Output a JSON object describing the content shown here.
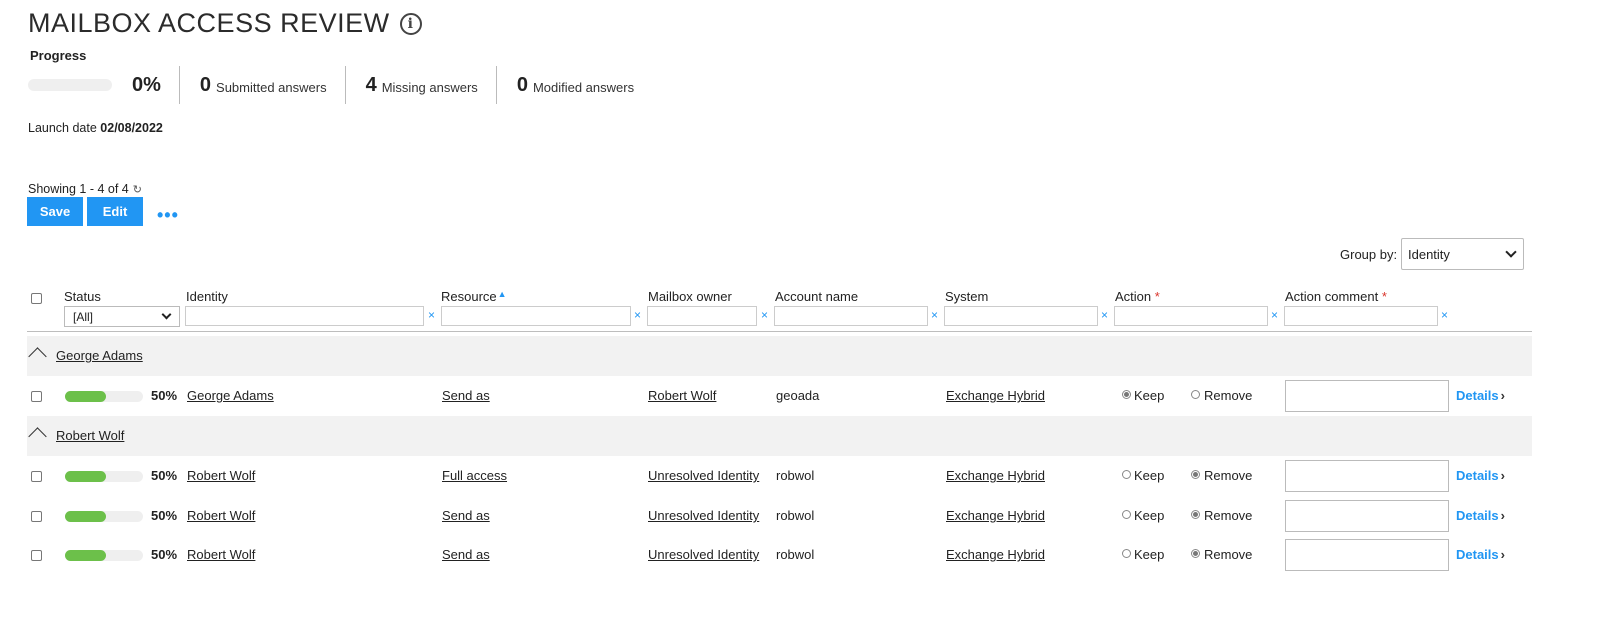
{
  "page": {
    "title": "MAILBOX ACCESS REVIEW",
    "info_icon": "info-icon"
  },
  "progress": {
    "label": "Progress",
    "percent_text": "0%",
    "percent_value": 0,
    "submitted": {
      "num": "0",
      "label": "Submitted answers"
    },
    "missing": {
      "num": "4",
      "label": "Missing answers"
    },
    "modified": {
      "num": "0",
      "label": "Modified answers"
    }
  },
  "launch": {
    "label": "Launch date",
    "date": "02/08/2022"
  },
  "list": {
    "showing": "Showing 1 - 4 of 4",
    "refresh_icon": "refresh-icon",
    "save_label": "Save",
    "edit_label": "Edit",
    "more_label": "•••"
  },
  "group_by": {
    "label": "Group by:",
    "value": "Identity"
  },
  "columns": {
    "status": "Status",
    "identity": "Identity",
    "resource": "Resource",
    "mailbox_owner": "Mailbox owner",
    "account_name": "Account name",
    "system": "System",
    "action": "Action",
    "action_comment": "Action comment",
    "required_mark": "*",
    "sort_icon": "sort-ascending-icon"
  },
  "filters": {
    "status_value": "[All]",
    "clear": "×"
  },
  "groups": [
    {
      "name": "George Adams",
      "rows": [
        {
          "pct": "50%",
          "progress": 0.5,
          "identity": "George Adams",
          "resource": "Send as",
          "owner": "Robert Wolf",
          "account": "geoada",
          "system": "Exchange Hybrid",
          "action": "Keep"
        }
      ]
    },
    {
      "name": "Robert Wolf",
      "rows": [
        {
          "pct": "50%",
          "progress": 0.5,
          "identity": "Robert Wolf",
          "resource": "Full access",
          "owner": "Unresolved Identity",
          "account": "robwol",
          "system": "Exchange Hybrid",
          "action": "Remove"
        },
        {
          "pct": "50%",
          "progress": 0.5,
          "identity": "Robert Wolf",
          "resource": "Send as",
          "owner": "Unresolved Identity",
          "account": "robwol",
          "system": "Exchange Hybrid",
          "action": "Remove"
        },
        {
          "pct": "50%",
          "progress": 0.5,
          "identity": "Robert Wolf",
          "resource": "Send as",
          "owner": "Unresolved Identity",
          "account": "robwol",
          "system": "Exchange Hybrid",
          "action": "Remove"
        }
      ]
    }
  ],
  "row_labels": {
    "keep": "Keep",
    "remove": "Remove",
    "details": "Details",
    "details_arrow": "›"
  },
  "colors": {
    "accent": "#2196f3",
    "progress_fill": "#6cc04a",
    "required": "#d9342b"
  }
}
